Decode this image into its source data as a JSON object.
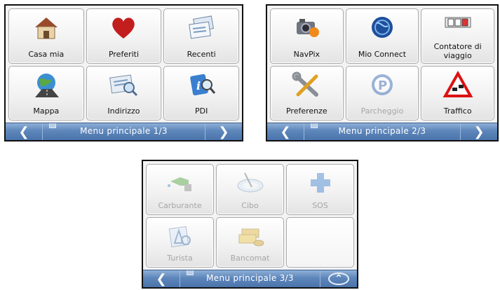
{
  "screens": [
    {
      "nav_title": "Menu principale 1/3",
      "back_symbol": "❮",
      "forward_symbol": "❯",
      "tiles": [
        {
          "label": "Casa mia",
          "icon": "house-icon"
        },
        {
          "label": "Preferiti",
          "icon": "heart-icon"
        },
        {
          "label": "Recenti",
          "icon": "recent-documents-icon"
        },
        {
          "label": "Mappa",
          "icon": "globe-road-icon"
        },
        {
          "label": "Indirizzo",
          "icon": "address-search-icon"
        },
        {
          "label": "PDI",
          "icon": "info-magnifier-icon"
        }
      ]
    },
    {
      "nav_title": "Menu principale 2/3",
      "back_symbol": "❮",
      "forward_symbol": "❯",
      "tiles": [
        {
          "label": "NavPix",
          "icon": "camera-icon"
        },
        {
          "label": "Mio Connect",
          "icon": "globe-connect-icon"
        },
        {
          "label": "Contatore di viaggio",
          "icon": "trip-counter-icon"
        },
        {
          "label": "Preferenze",
          "icon": "tools-icon"
        },
        {
          "label": "Parcheggio",
          "icon": "parking-icon",
          "disabled": true
        },
        {
          "label": "Traffico",
          "icon": "traffic-warning-icon"
        }
      ]
    },
    {
      "nav_title": "Menu principale 3/3",
      "back_symbol": "❮",
      "up_symbol": "⌃",
      "tiles": [
        {
          "label": "Carburante",
          "icon": "fuel-nozzle-icon",
          "disabled": true
        },
        {
          "label": "Cibo",
          "icon": "food-plate-icon",
          "disabled": true
        },
        {
          "label": "SOS",
          "icon": "medical-cross-icon",
          "disabled": true
        },
        {
          "label": "Turista",
          "icon": "tourist-map-icon",
          "disabled": true
        },
        {
          "label": "Bancomat",
          "icon": "money-icon",
          "disabled": true
        },
        {
          "label": "",
          "icon": ""
        }
      ]
    }
  ],
  "colors": {
    "navbar": "#5e86bb",
    "tile_border": "#a9a9a9",
    "disabled_text": "#a6a6a6"
  }
}
